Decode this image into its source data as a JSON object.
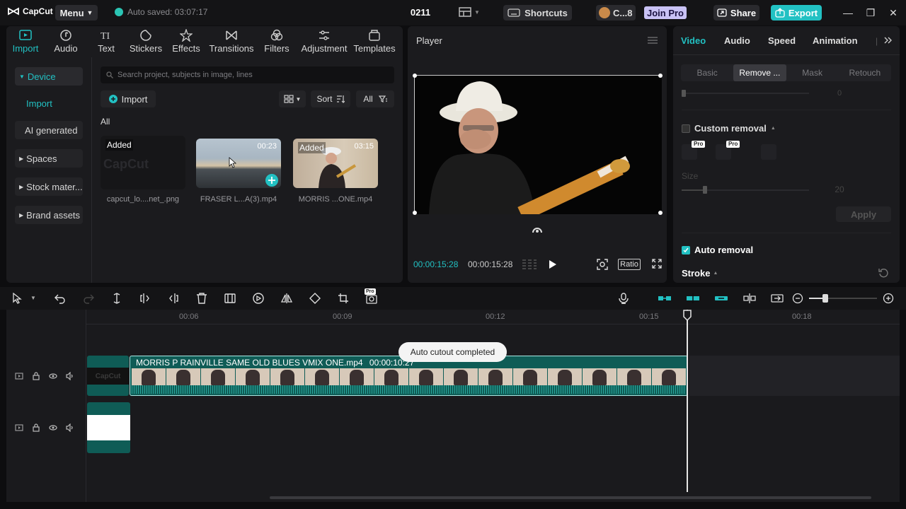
{
  "app": {
    "name": "CapCut",
    "menu_label": "Menu",
    "autosave": "Auto saved: 03:07:17",
    "project_name": "0211"
  },
  "header": {
    "shortcuts": "Shortcuts",
    "user": "C...8",
    "join_pro": "Join Pro",
    "share": "Share",
    "export": "Export"
  },
  "tools": [
    {
      "label": "Import",
      "icon": "import-icon"
    },
    {
      "label": "Audio",
      "icon": "audio-icon"
    },
    {
      "label": "Text",
      "icon": "text-icon"
    },
    {
      "label": "Stickers",
      "icon": "stickers-icon"
    },
    {
      "label": "Effects",
      "icon": "effects-icon"
    },
    {
      "label": "Transitions",
      "icon": "transitions-icon"
    },
    {
      "label": "Filters",
      "icon": "filters-icon"
    },
    {
      "label": "Adjustment",
      "icon": "adjustment-icon"
    },
    {
      "label": "Templates",
      "icon": "templates-icon"
    }
  ],
  "sidebar": {
    "items": [
      "Device",
      "Import",
      "AI generated",
      "Spaces",
      "Stock mater...",
      "Brand assets"
    ]
  },
  "media": {
    "search_placeholder": "Search project, subjects in image, lines",
    "import_label": "Import",
    "sort_label": "Sort",
    "filter_label": "All",
    "section_label": "All",
    "items": [
      {
        "name": "capcut_lo....net_.png",
        "badge": "Added",
        "duration": ""
      },
      {
        "name": "FRASER L...A(3).mp4",
        "badge": "",
        "duration": "00:23"
      },
      {
        "name": "MORRIS ...ONE.mp4",
        "badge": "Added",
        "duration": "03:15"
      }
    ],
    "watermark": "CapCut"
  },
  "player": {
    "title": "Player",
    "current_time": "00:00:15:28",
    "total_time": "00:00:15:28",
    "ratio_label": "Ratio"
  },
  "inspector": {
    "tabs": [
      "Video",
      "Audio",
      "Speed",
      "Animation"
    ],
    "subtabs": [
      "Basic",
      "Remove ...",
      "Mask",
      "Retouch"
    ],
    "slider_value_top": "0",
    "custom_removal": "Custom removal",
    "pro_badge": "Pro",
    "size_label": "Size",
    "size_value": "20",
    "apply": "Apply",
    "auto_removal": "Auto removal",
    "stroke": "Stroke"
  },
  "timeline": {
    "ruler": [
      "00:06",
      "00:09",
      "00:12",
      "00:15",
      "00:18"
    ],
    "clip_title": "MORRIS P RAINVILLE SAME OLD BLUES VMIX ONE.mp4",
    "clip_duration": "00:00:10:27",
    "toast": "Auto cutout completed",
    "watermark": "CapCut"
  },
  "colors": {
    "accent": "#22c1c3",
    "pro": "#c9c2f5"
  }
}
